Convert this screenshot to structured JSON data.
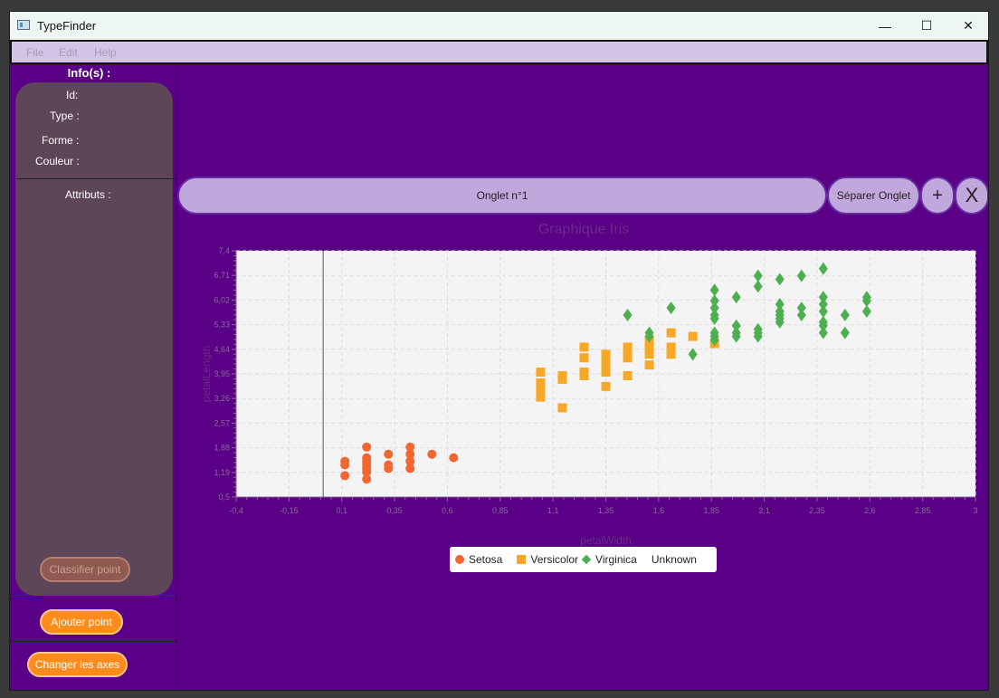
{
  "window": {
    "title": "TypeFinder"
  },
  "window_controls": {
    "minimize": "—",
    "maximize": "☐",
    "close": "✕"
  },
  "menu": [
    "File",
    "Edit",
    "Help"
  ],
  "info": {
    "title": "Info(s) :",
    "id_label": "Id:",
    "type_label": "Type :",
    "forme_label": "Forme :",
    "couleur_label": "Couleur :",
    "attributs_label": "Attributs :"
  },
  "buttons": {
    "classifier": "Classifier point",
    "ajouter": "Ajouter point",
    "changer_axes": "Changer les axes"
  },
  "tabs": {
    "current": "Onglet n°1",
    "separate": "Séparer Onglet",
    "add": "+",
    "close": "X"
  },
  "colors": {
    "setosa": "#f4662f",
    "versicolor": "#f9a826",
    "virginica": "#4caf50",
    "plot_bg": "#f4f4f4"
  },
  "chart_data": {
    "type": "scatter",
    "title": "Graphique Iris",
    "xlabel": "petalWidth",
    "ylabel": "petalLength",
    "xlim": [
      -0.4,
      3.0
    ],
    "ylim": [
      0.5,
      7.4
    ],
    "x_ticks": [
      "-0,4",
      "-0,15",
      "0,1",
      "0,35",
      "0,6",
      "0,85",
      "1,1",
      "1,35",
      "1,6",
      "1,85",
      "2,1",
      "2,35",
      "2,6",
      "2,85",
      "3"
    ],
    "y_ticks": [
      "0,5",
      "1,19",
      "1,88",
      "2,57",
      "3,26",
      "3,95",
      "4,64",
      "5,33",
      "6,02",
      "6,71",
      "7,4"
    ],
    "grid": true,
    "legend_position": "bottom",
    "series": [
      {
        "name": "Setosa",
        "marker": "circle",
        "points": [
          [
            0.1,
            1.4
          ],
          [
            0.1,
            1.5
          ],
          [
            0.1,
            1.1
          ],
          [
            0.2,
            1.4
          ],
          [
            0.2,
            1.3
          ],
          [
            0.2,
            1.5
          ],
          [
            0.2,
            1.6
          ],
          [
            0.2,
            1.2
          ],
          [
            0.2,
            1.0
          ],
          [
            0.2,
            1.9
          ],
          [
            0.3,
            1.4
          ],
          [
            0.3,
            1.3
          ],
          [
            0.3,
            1.7
          ],
          [
            0.4,
            1.5
          ],
          [
            0.4,
            1.7
          ],
          [
            0.4,
            1.9
          ],
          [
            0.4,
            1.3
          ],
          [
            0.5,
            1.7
          ],
          [
            0.6,
            1.6
          ]
        ]
      },
      {
        "name": "Versicolor",
        "marker": "square",
        "points": [
          [
            1.0,
            3.5
          ],
          [
            1.0,
            4.0
          ],
          [
            1.0,
            3.3
          ],
          [
            1.0,
            3.7
          ],
          [
            1.1,
            3.0
          ],
          [
            1.1,
            3.9
          ],
          [
            1.1,
            3.8
          ],
          [
            1.2,
            4.0
          ],
          [
            1.2,
            4.4
          ],
          [
            1.2,
            4.7
          ],
          [
            1.2,
            3.9
          ],
          [
            1.3,
            4.0
          ],
          [
            1.3,
            4.3
          ],
          [
            1.3,
            4.5
          ],
          [
            1.3,
            3.6
          ],
          [
            1.3,
            4.1
          ],
          [
            1.4,
            4.7
          ],
          [
            1.4,
            4.4
          ],
          [
            1.4,
            3.9
          ],
          [
            1.4,
            4.6
          ],
          [
            1.5,
            4.5
          ],
          [
            1.5,
            4.2
          ],
          [
            1.5,
            4.7
          ],
          [
            1.5,
            4.9
          ],
          [
            1.6,
            4.5
          ],
          [
            1.6,
            5.1
          ],
          [
            1.6,
            4.7
          ],
          [
            1.7,
            5.0
          ],
          [
            1.8,
            4.8
          ]
        ]
      },
      {
        "name": "Virginica",
        "marker": "diamond",
        "points": [
          [
            1.4,
            5.6
          ],
          [
            1.5,
            5.0
          ],
          [
            1.5,
            5.1
          ],
          [
            1.6,
            5.8
          ],
          [
            1.7,
            4.5
          ],
          [
            1.8,
            4.9
          ],
          [
            1.8,
            5.0
          ],
          [
            1.8,
            5.1
          ],
          [
            1.8,
            5.5
          ],
          [
            1.8,
            5.6
          ],
          [
            1.8,
            5.8
          ],
          [
            1.8,
            6.0
          ],
          [
            1.8,
            6.3
          ],
          [
            1.9,
            5.0
          ],
          [
            1.9,
            5.1
          ],
          [
            1.9,
            5.3
          ],
          [
            1.9,
            6.1
          ],
          [
            2.0,
            5.0
          ],
          [
            2.0,
            5.1
          ],
          [
            2.0,
            5.2
          ],
          [
            2.0,
            6.4
          ],
          [
            2.0,
            6.7
          ],
          [
            2.1,
            5.4
          ],
          [
            2.1,
            5.5
          ],
          [
            2.1,
            5.6
          ],
          [
            2.1,
            5.7
          ],
          [
            2.1,
            5.9
          ],
          [
            2.1,
            6.6
          ],
          [
            2.2,
            5.6
          ],
          [
            2.2,
            5.8
          ],
          [
            2.2,
            6.7
          ],
          [
            2.3,
            5.1
          ],
          [
            2.3,
            5.3
          ],
          [
            2.3,
            5.4
          ],
          [
            2.3,
            5.7
          ],
          [
            2.3,
            5.9
          ],
          [
            2.3,
            6.1
          ],
          [
            2.3,
            6.9
          ],
          [
            2.4,
            5.1
          ],
          [
            2.4,
            5.6
          ],
          [
            2.5,
            5.7
          ],
          [
            2.5,
            6.0
          ],
          [
            2.5,
            6.1
          ]
        ]
      }
    ]
  },
  "legend": [
    "Setosa",
    "Versicolor",
    "Virginica",
    "Unknown"
  ]
}
